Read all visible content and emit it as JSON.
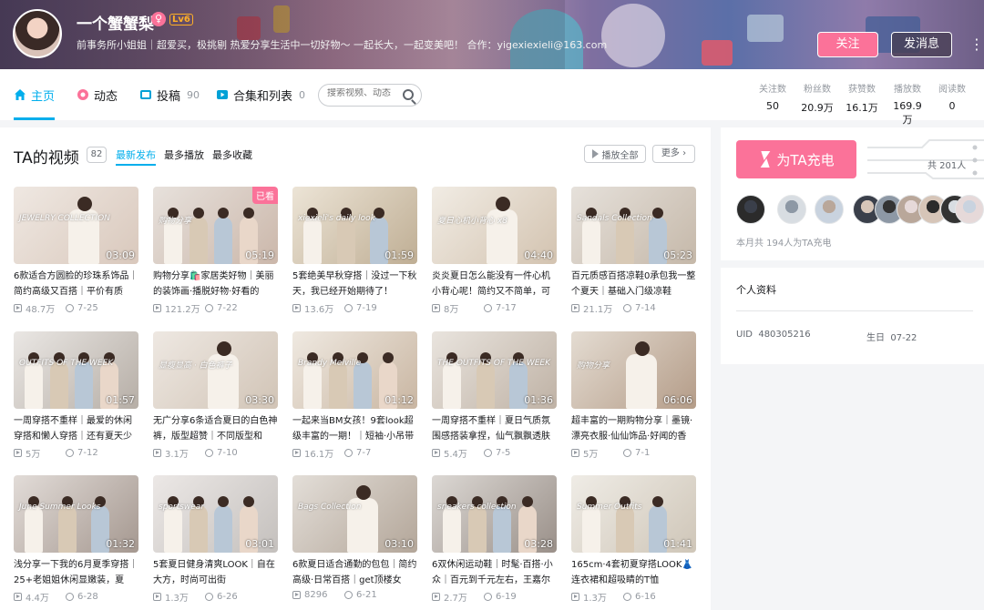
{
  "header": {
    "username": "一个蟹蟹梨",
    "gender_symbol": "♀",
    "level": "Lv6",
    "signature": "前事务所小姐姐｜超爱买，极挑剔 热爱分享生活中一切好物～ 一起长大，一起变美吧！ 合作：yigexiexieli@163.com",
    "follow_label": "关注",
    "message_label": "发消息",
    "more_glyph": "⋮"
  },
  "nav": {
    "items": [
      {
        "label": "主页",
        "count": "",
        "icon": "home-icon"
      },
      {
        "label": "动态",
        "count": "",
        "icon": "dynamic-icon"
      },
      {
        "label": "投稿",
        "count": "90",
        "icon": "upload-icon"
      },
      {
        "label": "合集和列表",
        "count": "0",
        "icon": "collection-icon"
      }
    ],
    "search_placeholder": "搜索视频、动态",
    "stats": [
      {
        "label": "关注数",
        "value": "50"
      },
      {
        "label": "粉丝数",
        "value": "20.9万"
      },
      {
        "label": "获赞数",
        "value": "16.1万"
      },
      {
        "label": "播放数",
        "value": "169.9万"
      },
      {
        "label": "阅读数",
        "value": "0"
      }
    ]
  },
  "videos": {
    "title": "TA的视频",
    "count": "82",
    "sort_tabs": [
      "最新发布",
      "最多播放",
      "最多收藏"
    ],
    "play_all": "播放全部",
    "more": "更多",
    "items": [
      {
        "title": "6款适合方圆脸的珍珠系饰品｜简约高级又百搭｜平价有质",
        "duration": "03:09",
        "views": "48.7万",
        "date": "7-25",
        "watched": "",
        "overlay": "JEWELRY COLLECTION"
      },
      {
        "title": "购物分享🛍️家居类好物｜美丽的装饰画·播脱好物·好看的",
        "duration": "05:19",
        "views": "121.2万",
        "date": "7-22",
        "watched": "已看",
        "overlay": "购物分享"
      },
      {
        "title": "5套绝美早秋穿搭｜没过一下秋天，我已经开始期待了！",
        "duration": "01:59",
        "views": "13.6万",
        "date": "7-19",
        "watched": "",
        "overlay": "xiexieli's daily look"
      },
      {
        "title": "炎炎夏日怎么能没有一件心机小背心呢！简约又不简单，可",
        "duration": "04:40",
        "views": "8万",
        "date": "7-17",
        "watched": "",
        "overlay": "夏日心机小背心 x8"
      },
      {
        "title": "百元质感百搭凉鞋0承包我一整个夏天｜基础入门级凉鞋",
        "duration": "05:23",
        "views": "21.1万",
        "date": "7-14",
        "watched": "",
        "overlay": "Sandals Collection"
      },
      {
        "title": "一周穿搭不重样｜最爱的休闲穿搭和懒人穿搭｜还有夏天少",
        "duration": "01:57",
        "views": "5万",
        "date": "7-12",
        "watched": "",
        "overlay": "OUTFITS OF THE WEEK"
      },
      {
        "title": "无广分享6条适合夏日的白色神裤，版型超赞｜不同版型和",
        "duration": "03:30",
        "views": "3.1万",
        "date": "7-10",
        "watched": "",
        "overlay": "显瘦显高 · 白色裤子"
      },
      {
        "title": "一起来当BM女孩！9套look超级丰富的一期！｜短袖·小吊带",
        "duration": "01:12",
        "views": "16.1万",
        "date": "7-7",
        "watched": "",
        "overlay": "Brandy Melville"
      },
      {
        "title": "一周穿搭不重样｜夏日气质氛围感搭装拿捏，仙气飘飘透肤",
        "duration": "01:36",
        "views": "5.4万",
        "date": "7-5",
        "watched": "",
        "overlay": "THE OUTFITS OF THE WEEK"
      },
      {
        "title": "超丰富的一期购物分享｜墨镜·漂亮衣服·仙仙饰品·好闻的香",
        "duration": "06:06",
        "views": "5万",
        "date": "7-1",
        "watched": "",
        "overlay": "购物分享"
      },
      {
        "title": "浅分享一下我的6月夏季穿搭｜25+老姐姐休闲显嫩装，夏",
        "duration": "01:32",
        "views": "4.4万",
        "date": "6-28",
        "watched": "",
        "overlay": "June Summer Looks"
      },
      {
        "title": "5套夏日健身清爽LOOK｜自在大方，时尚可出街",
        "duration": "03:01",
        "views": "1.3万",
        "date": "6-26",
        "watched": "",
        "overlay": "sportswear"
      },
      {
        "title": "6款夏日适合通勤的包包｜简约高级·日常百搭｜get顶楼女",
        "duration": "03:10",
        "views": "8296",
        "date": "6-21",
        "watched": "",
        "overlay": "Bags Collection"
      },
      {
        "title": "6双休闲运动鞋｜时髦·百搭·小众｜百元到千元左右，王嘉尔",
        "duration": "03:28",
        "views": "2.7万",
        "date": "6-19",
        "watched": "",
        "overlay": "sneakers collection"
      },
      {
        "title": "165cm·4套初夏穿搭LOOK👗连衣裙和超吸睛的T恤",
        "duration": "01:41",
        "views": "1.3万",
        "date": "6-16",
        "watched": "",
        "overlay": "Summer Outfits"
      }
    ]
  },
  "charge": {
    "button_label": "为TA充电",
    "total_text": "共 201人",
    "note": "本月共 194人为TA充电",
    "fan_count_shown": 9
  },
  "profile": {
    "title": "个人资料",
    "uid_label": "UID",
    "uid": "480305216",
    "birthday_label": "生日",
    "birthday": "07-22"
  },
  "colors": {
    "accent": "#00aeec",
    "pink": "#fb7299",
    "text": "#18191c",
    "muted": "#9499a0"
  }
}
